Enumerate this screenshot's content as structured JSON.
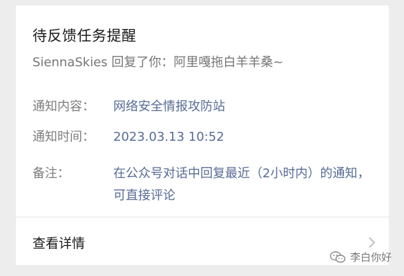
{
  "card": {
    "title": "待反馈任务提醒",
    "subtitle": "SiennaSkies 回复了你：阿里嘎拖白羊羊桑~",
    "fields": [
      {
        "label": "通知内容：",
        "value": "网络安全情报攻防站"
      },
      {
        "label": "通知时间：",
        "value": "2023.03.13 10:52"
      },
      {
        "label": "备注：",
        "value": "在公众号对话中回复最近（2小时内）的通知，可直接评论"
      }
    ],
    "footer_label": "查看详情"
  },
  "watermark": {
    "text": "李白你好",
    "icon": "wechat-icon"
  },
  "colors": {
    "background": "#ededed",
    "card": "#ffffff",
    "title": "#1a1a1a",
    "label": "#7d7d7d",
    "value_link": "#576b95"
  }
}
